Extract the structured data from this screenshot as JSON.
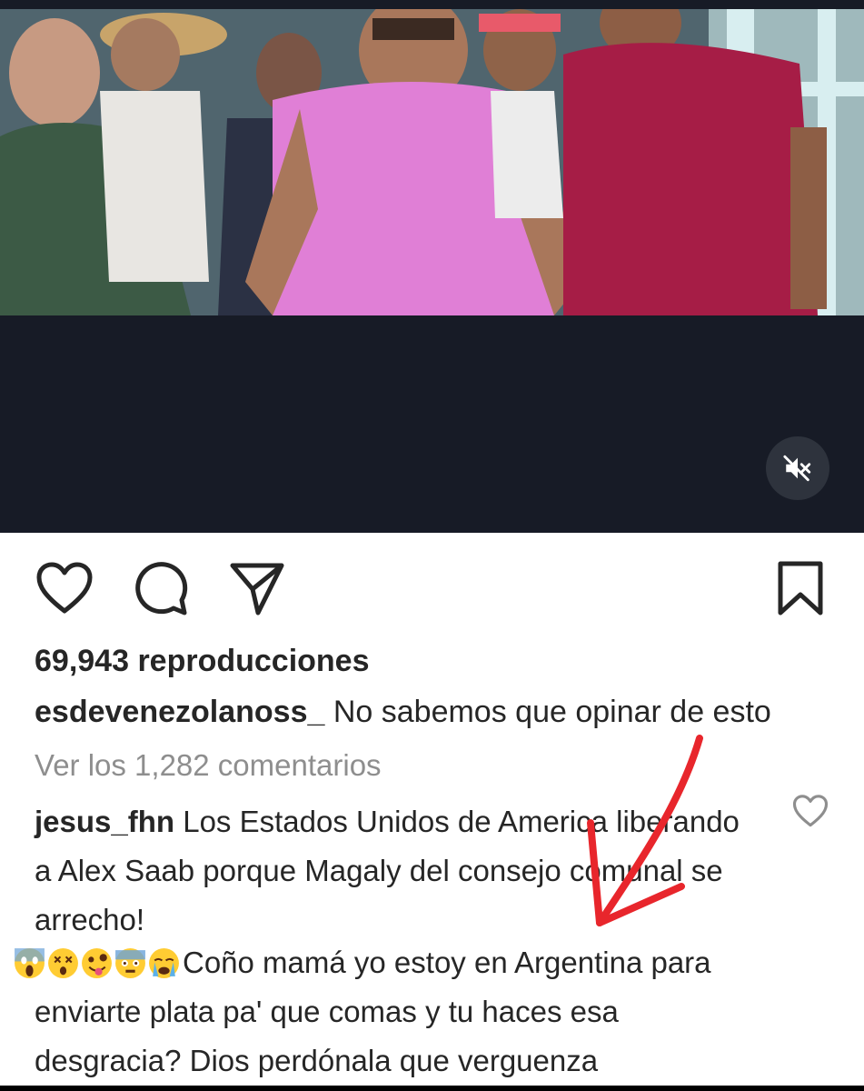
{
  "video": {
    "icons": {
      "mute": "mute-speaker-icon"
    }
  },
  "actions": {
    "icons": [
      "heart-icon",
      "comment-icon",
      "share-icon",
      "bookmark-icon"
    ]
  },
  "post": {
    "views_text": "69,943 reproducciones",
    "author": "esdevenezolanoss_",
    "caption": "No sabemos que opinar de esto",
    "view_comments": "Ver los 1,282 comentarios"
  },
  "comments": [
    {
      "username": "jesus_fhn",
      "text": "Los Estados Unidos de America liberando a Alex Saab porque Magaly del consejo comunal se arrecho!"
    },
    {
      "emojis": [
        "scream-emoji",
        "dizzy-face-emoji",
        "zany-face-emoji",
        "face-with-head-bandage-emoji",
        "crying-emoji"
      ],
      "line1": "Coño mamá yo estoy en Argentina para",
      "line2": "enviarte plata pa' que comas y tu haces esa",
      "line3": "desgracia? Dios perdónala que verguenza"
    }
  ],
  "colors": {
    "video_bg": "#171b26",
    "annotation_arrow": "#e8262c",
    "muted_text": "#8e8e8e"
  }
}
